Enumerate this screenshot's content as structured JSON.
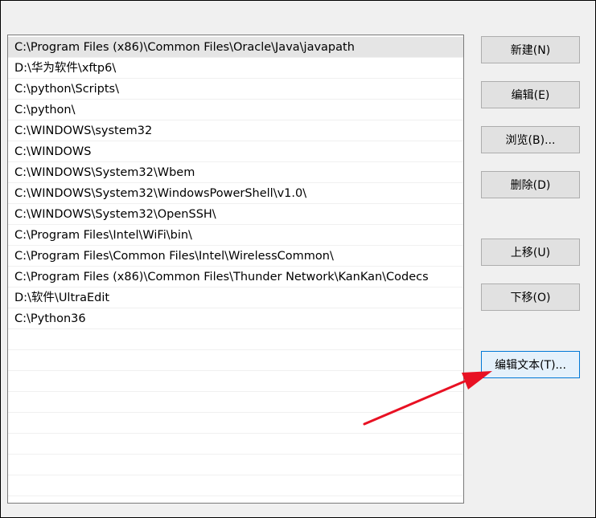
{
  "path_list": {
    "rows": [
      "C:\\Program Files (x86)\\Common Files\\Oracle\\Java\\javapath",
      "D:\\华为软件\\xftp6\\",
      "C:\\python\\Scripts\\",
      "C:\\python\\",
      "C:\\WINDOWS\\system32",
      "C:\\WINDOWS",
      "C:\\WINDOWS\\System32\\Wbem",
      "C:\\WINDOWS\\System32\\WindowsPowerShell\\v1.0\\",
      "C:\\WINDOWS\\System32\\OpenSSH\\",
      "C:\\Program Files\\Intel\\WiFi\\bin\\",
      "C:\\Program Files\\Common Files\\Intel\\WirelessCommon\\",
      "C:\\Program Files (x86)\\Common Files\\Thunder Network\\KanKan\\Codecs",
      "D:\\软件\\UltraEdit",
      "C:\\Python36",
      "",
      "",
      "",
      "",
      "",
      "",
      "",
      ""
    ],
    "selected_index": 0
  },
  "buttons": {
    "new": "新建(N)",
    "edit": "编辑(E)",
    "browse": "浏览(B)...",
    "delete": "删除(D)",
    "move_up": "上移(U)",
    "move_down": "下移(O)",
    "edit_text": "编辑文本(T)..."
  },
  "colors": {
    "annotation_arrow": "#e81123",
    "selection": "#e5e5e5",
    "focus_border": "#0078d7"
  }
}
